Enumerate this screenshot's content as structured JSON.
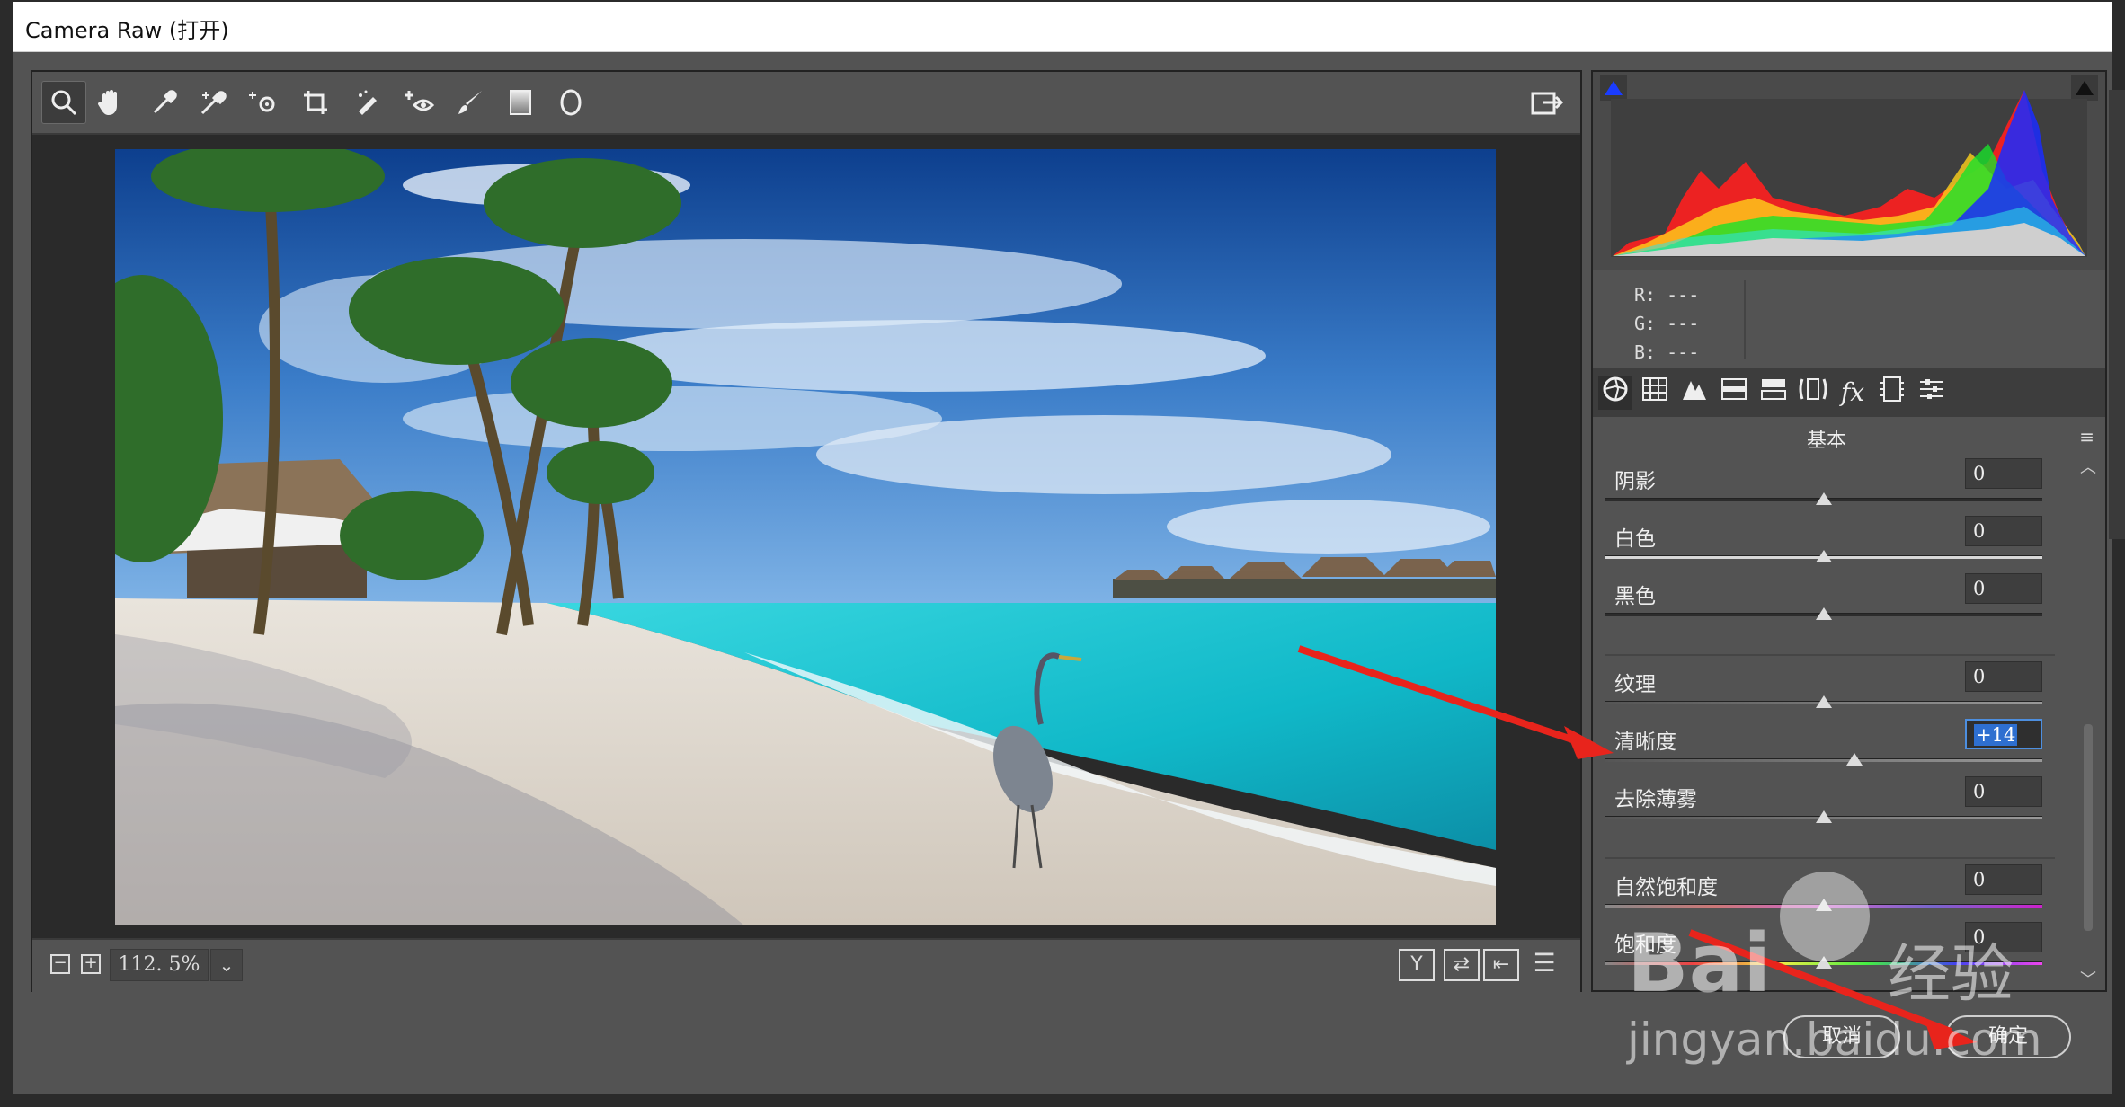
{
  "window": {
    "title": "Camera Raw (打开)"
  },
  "toolbar": {
    "tools": [
      {
        "name": "zoom",
        "glyph": "🔍"
      },
      {
        "name": "hand",
        "glyph": "✋"
      },
      {
        "name": "white-balance",
        "glyph": "⚲"
      },
      {
        "name": "color-sampler",
        "glyph": "✦"
      },
      {
        "name": "targeted-adjust",
        "glyph": "⊹"
      },
      {
        "name": "crop",
        "glyph": "⧉"
      },
      {
        "name": "spot-removal",
        "glyph": "✎"
      },
      {
        "name": "red-eye",
        "glyph": "⊕"
      },
      {
        "name": "adjustment-brush",
        "glyph": "🖌"
      },
      {
        "name": "graduated-filter",
        "glyph": "▮"
      },
      {
        "name": "radial-filter",
        "glyph": "◯"
      }
    ],
    "export_glyph": "⇲"
  },
  "status": {
    "zoom_out": "−",
    "zoom_in": "+",
    "zoom_value": "112. 5%",
    "zoom_dropdown": "⌄",
    "view_y": "Y",
    "swap": "⇄",
    "copy": "⇤",
    "prefs": "☰"
  },
  "histogram": {
    "readout": {
      "r": "R:   ---",
      "g": "G:   ---",
      "b": "B:   ---"
    }
  },
  "panel": {
    "title": "基本",
    "menu_glyph": "≡",
    "sliders": [
      {
        "label": "阴影",
        "value": "0",
        "pos": 0.5
      },
      {
        "label": "白色",
        "value": "0",
        "pos": 0.5
      },
      {
        "label": "黑色",
        "value": "0",
        "pos": 0.5
      },
      {
        "label": "纹理",
        "value": "0",
        "pos": 0.5
      },
      {
        "label": "清晰度",
        "value": "+14",
        "pos": 0.57
      },
      {
        "label": "去除薄雾",
        "value": "0",
        "pos": 0.5
      },
      {
        "label": "自然饱和度",
        "value": "0",
        "pos": 0.5
      },
      {
        "label": "饱和度",
        "value": "0",
        "pos": 0.5
      }
    ]
  },
  "buttons": {
    "cancel": "取消",
    "ok": "确定"
  },
  "watermark": {
    "brand": "Bai",
    "brand2": "经验",
    "url": "jingyan.baidu.com"
  },
  "colors": {
    "accent": "#2e6fd0",
    "panel": "#535353",
    "dark": "#2a2a2a",
    "arrow": "#e8241c"
  }
}
